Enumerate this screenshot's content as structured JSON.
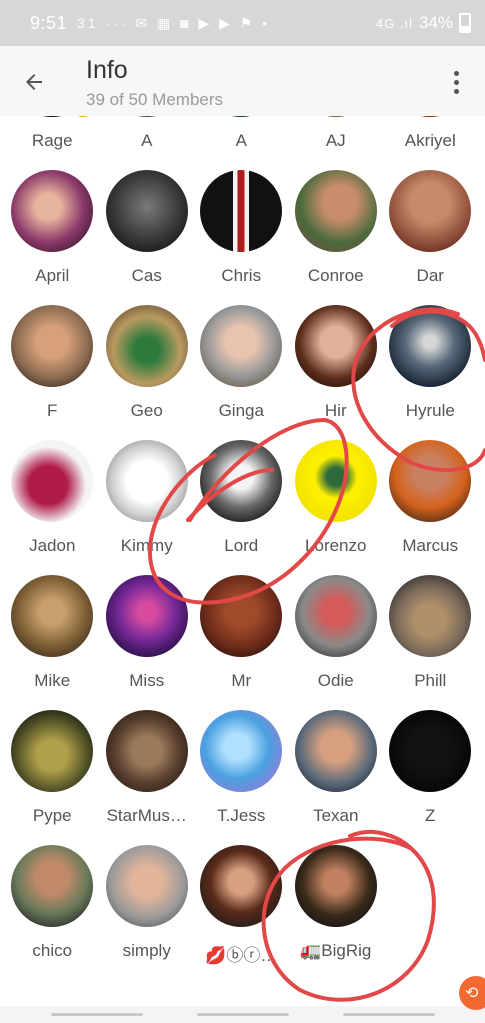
{
  "status_bar": {
    "time": "9:51",
    "icons": "31 ··· ✉ ▦ ◙ ▶ ▶ ⚑ •",
    "signal": "4G .ıl",
    "battery": "34%"
  },
  "header": {
    "title": "Info",
    "subtitle": "39 of 50 Members"
  },
  "members": [
    [
      {
        "name": "Rage",
        "bg": "radial-gradient(circle at 50% 20%, #6a2a2a, #1a0a0a 70%)",
        "badge": "♛"
      },
      {
        "name": "A",
        "bg": "radial-gradient(circle at 50% 30%, #bdbdbd, #555 70%)"
      },
      {
        "name": "A",
        "bg": "radial-gradient(circle at 50% 40%, #2f8a9a, #0e3c4a 70%)"
      },
      {
        "name": "AJ",
        "bg": "radial-gradient(circle at 50% 40%, #d9a889, #8b5a42 70%)"
      },
      {
        "name": "Akriyel",
        "bg": "radial-gradient(circle at 50% 40%, #e88a3a, #8a3c10 70%)"
      }
    ],
    [
      {
        "name": "April",
        "bg": "radial-gradient(circle at 45% 45%, #e7b49e 20%, #8c3a6a 55%, #4a1d3a 80%)"
      },
      {
        "name": "Cas",
        "bg": "radial-gradient(circle at 50% 45%, #7a7a7a, #1f1f1f 75%)"
      },
      {
        "name": "Chris",
        "bg": "linear-gradient(90deg, #111 0 40%, #f2f2f2 40% 46%, #b01c1c 46% 54%, #f2f2f2 54% 60%, #111 60%)"
      },
      {
        "name": "Conroe",
        "bg": "radial-gradient(circle at 55% 40%, #c98d6b 25%, #4a6a3c 60%, #6a5040 85%)"
      },
      {
        "name": "Dar",
        "bg": "radial-gradient(circle at 50% 40%, #c98a6a 30%, #7a3a2a 75%)"
      }
    ],
    [
      {
        "name": "F",
        "bg": "radial-gradient(circle at 50% 45%, #d7a07a 25%, #8a6a50 60%, #3c2c22 85%)"
      },
      {
        "name": "Geo",
        "bg": "radial-gradient(circle at 50% 55%, #2c7a3c 20%, #b89a60 55%, #6a5034 85%)"
      },
      {
        "name": "Ginga",
        "bg": "radial-gradient(circle at 50% 45%, #e8c4b0 25%, #9a9a9a 55%, #6a5a4a 85%)"
      },
      {
        "name": "Hir",
        "bg": "radial-gradient(circle at 50% 45%, #e0b099 25%, #5a2c1a 60%, #2a1410 85%)"
      },
      {
        "name": "Hyrule",
        "bg": "radial-gradient(circle at 50% 45%, #d6d6d6 10%, #5a6a7a 40%, #0e1a2a 80%)"
      }
    ],
    [
      {
        "name": "Jadon",
        "bg": "radial-gradient(circle at 45% 55%, #b01c4a 30%, #f4f4f4 60%)"
      },
      {
        "name": "Kimmy",
        "bg": "radial-gradient(circle at 50% 50%, #ffffff 35%, #cfcfcf 60%, #8a8a8a 85%)"
      },
      {
        "name": "Lord",
        "bg": "radial-gradient(circle at 50% 45%, #f4f4f4 20%, #6a6a6a 50%, #1a1a1a 80%)"
      },
      {
        "name": "Lorenzo",
        "bg": "radial-gradient(circle at 50% 45%, #2c6a3c 15%, #fff000 35%, #f0e000 80%)"
      },
      {
        "name": "Marcus",
        "bg": "radial-gradient(circle at 50% 40%, #c98060 25%, #d4621c 55%, #4a2a1a 85%)"
      }
    ],
    [
      {
        "name": "Mike",
        "bg": "radial-gradient(circle at 50% 45%, #c9a070 20%, #8a6a3c 50%, #3c2a1a 85%)"
      },
      {
        "name": "Miss",
        "bg": "radial-gradient(circle at 50% 45%, #d64aa0 15%, #7a2a9a 45%, #1a0a3a 85%)"
      },
      {
        "name": "Mr",
        "bg": "radial-gradient(circle at 50% 45%, #a04a2a 25%, #6a2a1a 60%, #2a120a 85%)"
      },
      {
        "name": "Odie",
        "bg": "radial-gradient(circle at 50% 45%, #d65a5a 20%, #8a8a8a 55%, #3a3a3a 85%)"
      },
      {
        "name": "Phill",
        "bg": "radial-gradient(circle at 50% 55%, #b0906a 25%, #7a6a5a 55%, #2a2a2a 85%)"
      }
    ],
    [
      {
        "name": "Pype",
        "bg": "radial-gradient(circle at 50% 55%, #b0a04a 25%, #5a5a2a 55%, #121212 85%)"
      },
      {
        "name": "StarMus…",
        "bg": "radial-gradient(circle at 50% 50%, #9a7a5a 25%, #5a4030 55%, #2a1c12 85%)"
      },
      {
        "name": "T.Jess",
        "bg": "radial-gradient(circle at 45% 45%, #b0e0ff 20%, #4aa0e0 50%, #9a7ad6 85%)"
      },
      {
        "name": "Texan",
        "bg": "radial-gradient(circle at 50% 45%, #d6a080 25%, #5a6a7a 60%, #2a2a3a 85%)"
      },
      {
        "name": "Z",
        "bg": "radial-gradient(circle at 50% 50%, #111 40%, #050505 80%)"
      }
    ],
    [
      {
        "name": "chico",
        "bg": "radial-gradient(circle at 50% 40%, #c08a6a 25%, #6a7a5a 55%, #2a2a2a 85%)"
      },
      {
        "name": "simply",
        "bg": "radial-gradient(circle at 50% 45%, #e2b49a 25%, #9a9a9a 60%, #5a5a5a 85%)"
      },
      {
        "name": "💋ⓑⓡ…",
        "bg": "radial-gradient(circle at 50% 45%, #d6a080 20%, #5a2a1a 50%, #1a1a1a 85%)"
      },
      {
        "name": "🚛BigRig",
        "bg": "radial-gradient(circle at 50% 45%, #c08060 20%, #3a2a1a 55%, #121212 85%)"
      }
    ]
  ],
  "fab": {
    "icon": "⟲"
  }
}
